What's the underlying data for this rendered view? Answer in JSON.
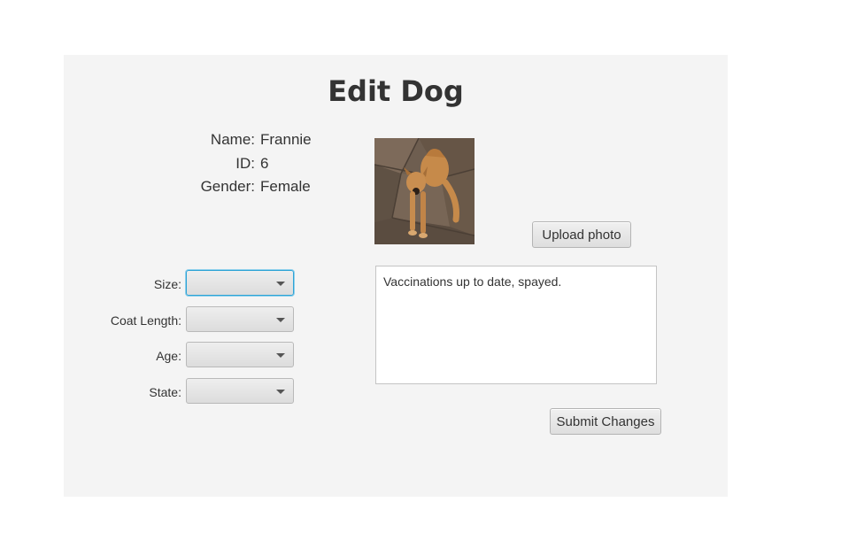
{
  "page": {
    "title": "Edit Dog"
  },
  "info": {
    "name_label": "Name:",
    "name_value": "Frannie",
    "id_label": "ID:",
    "id_value": "6",
    "gender_label": "Gender:",
    "gender_value": "Female"
  },
  "photo": {
    "upload_label": "Upload photo"
  },
  "form": {
    "size_label": "Size:",
    "size_value": "",
    "coat_label": "Coat Length:",
    "coat_value": "",
    "age_label": "Age:",
    "age_value": "",
    "state_label": "State:",
    "state_value": ""
  },
  "notes": {
    "text": "Vaccinations up to date, spayed."
  },
  "actions": {
    "submit_label": "Submit Changes"
  },
  "colors": {
    "panel_bg": "#f4f4f4",
    "focus_border": "#2ea3d6"
  }
}
